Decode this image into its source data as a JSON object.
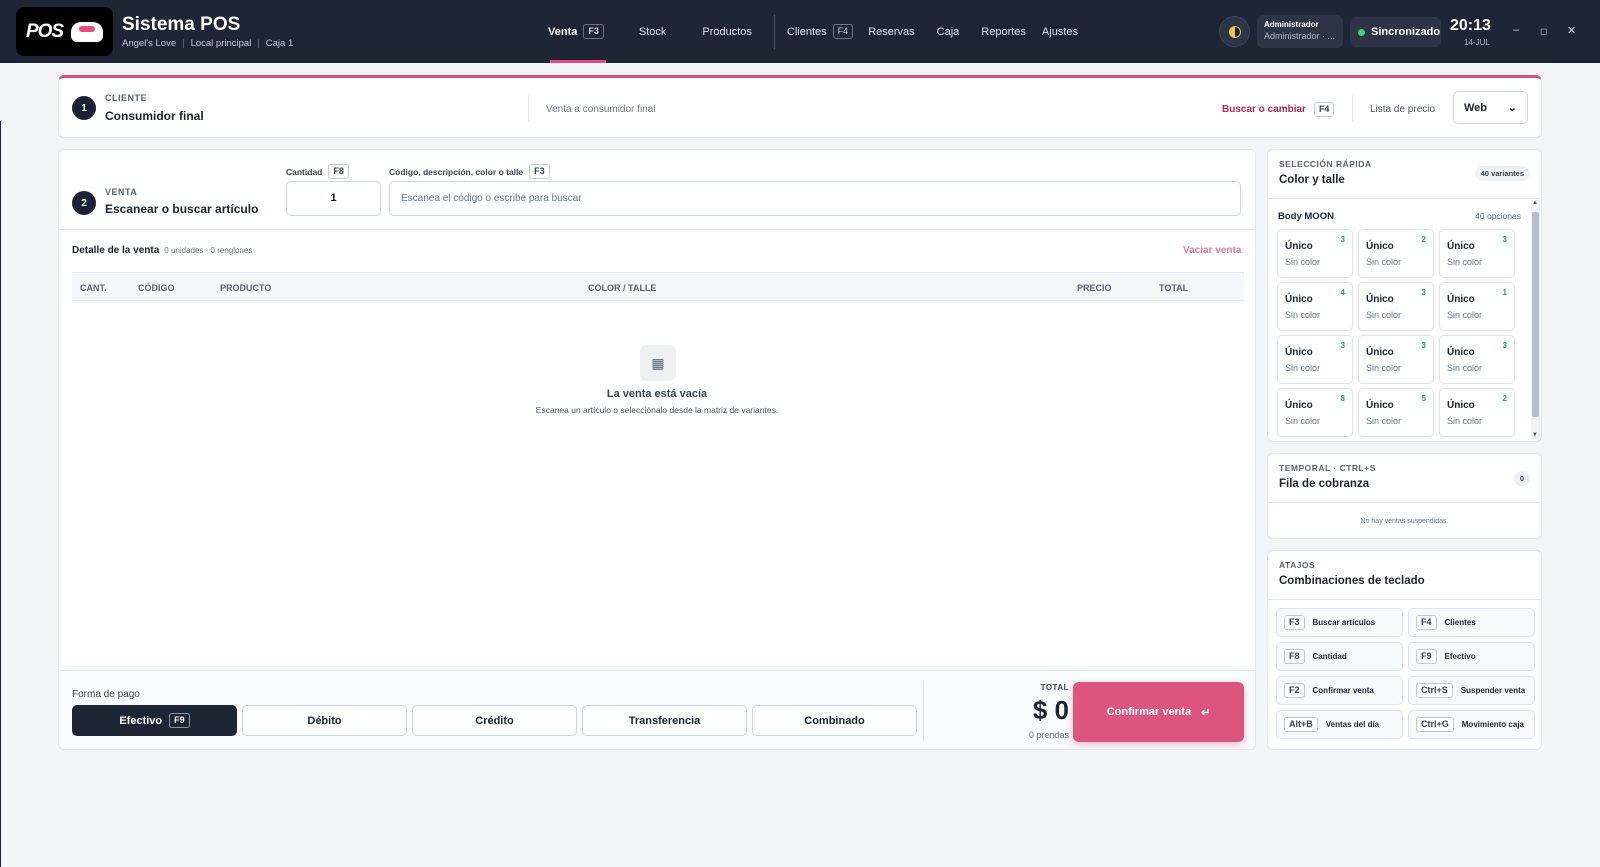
{
  "app": {
    "title": "Sistema POS",
    "store": "Angel's Love",
    "location": "Local principal",
    "register": "Caja 1",
    "logo_text": "POS"
  },
  "nav": [
    {
      "label": "Venta",
      "key": "F3",
      "active": true
    },
    {
      "label": "Stock",
      "key": ""
    },
    {
      "label": "Productos",
      "key": ""
    },
    {
      "label": "Clientes",
      "key": "F4"
    },
    {
      "label": "Reservas",
      "key": ""
    },
    {
      "label": "Caja",
      "key": ""
    },
    {
      "label": "Reportes",
      "key": ""
    },
    {
      "label": "Ajustes",
      "key": ""
    }
  ],
  "header": {
    "user_role": "Administrador",
    "user_name": "Administrador · ...",
    "sync": "Sincronizado",
    "time": "20:13",
    "date": "14-JUL"
  },
  "window_controls": {
    "minimize": "–",
    "maximize": "◻",
    "close": "✕"
  },
  "client": {
    "step": "1",
    "label": "CLIENTE",
    "value": "Consumidor final",
    "description": "Venta a consumidor final",
    "change_label": "Buscar o cambiar",
    "change_key": "F4",
    "price_list_label": "Lista de precio",
    "price_list_value": "Web"
  },
  "sale": {
    "step": "2",
    "label": "VENTA",
    "title": "Escanear o buscar artículo",
    "qty_label": "Cantidad",
    "qty_key": "F8",
    "qty_value": "1",
    "search_label": "Código, descripción, color o talle",
    "search_key": "F3",
    "search_placeholder": "Escanea el código o escribe para buscar"
  },
  "detail": {
    "title": "Detalle de la venta",
    "meta": "0 unidades · 0 renglones",
    "clear": "Vaciar venta",
    "columns": [
      "CANT.",
      "CÓDIGO",
      "PRODUCTO",
      "COLOR / TALLE",
      "PRECIO",
      "TOTAL"
    ],
    "empty_title": "La venta está vacía",
    "empty_sub": "Escanea un artículo o selecciónalo desde la matriz de variantes."
  },
  "payment": {
    "label": "Forma de pago",
    "methods": [
      {
        "label": "Efectivo",
        "key": "F9",
        "active": true
      },
      {
        "label": "Débito"
      },
      {
        "label": "Crédito"
      },
      {
        "label": "Transferencia"
      },
      {
        "label": "Combinado"
      }
    ]
  },
  "total": {
    "label": "TOTAL",
    "value": "$ 0",
    "items": "0 prendas",
    "confirm": "Confirmar venta",
    "confirm_icon": "↵"
  },
  "quick": {
    "label": "SELECCIÓN RÁPIDA",
    "title": "Color y talle",
    "badge": "40 variantes",
    "product": "Body MOON",
    "options": "40 opciones",
    "variants": [
      {
        "size": "Único",
        "color": "Sin color",
        "stock": "3"
      },
      {
        "size": "Único",
        "color": "Sin color",
        "stock": "2"
      },
      {
        "size": "Único",
        "color": "Sin color",
        "stock": "3"
      },
      {
        "size": "Único",
        "color": "Sin color",
        "stock": "4"
      },
      {
        "size": "Único",
        "color": "Sin color",
        "stock": "3"
      },
      {
        "size": "Único",
        "color": "Sin color",
        "stock": "1"
      },
      {
        "size": "Único",
        "color": "Sin color",
        "stock": "3"
      },
      {
        "size": "Único",
        "color": "Sin color",
        "stock": "3"
      },
      {
        "size": "Único",
        "color": "Sin color",
        "stock": "3"
      },
      {
        "size": "Único",
        "color": "Sin color",
        "stock": "8"
      },
      {
        "size": "Único",
        "color": "Sin color",
        "stock": "5"
      },
      {
        "size": "Único",
        "color": "Sin color",
        "stock": "2"
      }
    ]
  },
  "temp": {
    "label": "TEMPORAL · CTRL+S",
    "title": "Fila de cobranza",
    "badge": "0",
    "empty": "No hay ventas suspendidas."
  },
  "shortcuts": {
    "label": "ATAJOS",
    "title": "Combinaciones de teclado",
    "items": [
      {
        "key": "F3",
        "label": "Buscar artículos"
      },
      {
        "key": "F4",
        "label": "Clientes"
      },
      {
        "key": "F8",
        "label": "Cantidad"
      },
      {
        "key": "F9",
        "label": "Efectivo"
      },
      {
        "key": "F2",
        "label": "Confirmar venta"
      },
      {
        "key": "Ctrl+S",
        "label": "Suspender venta"
      },
      {
        "key": "Alt+B",
        "label": "Ventas del día"
      },
      {
        "key": "Ctrl+G",
        "label": "Movimiento caja"
      }
    ]
  },
  "colors": {
    "accent": "#db5580",
    "dark": "#1e2535",
    "stock_green": "#2a9a5c"
  }
}
